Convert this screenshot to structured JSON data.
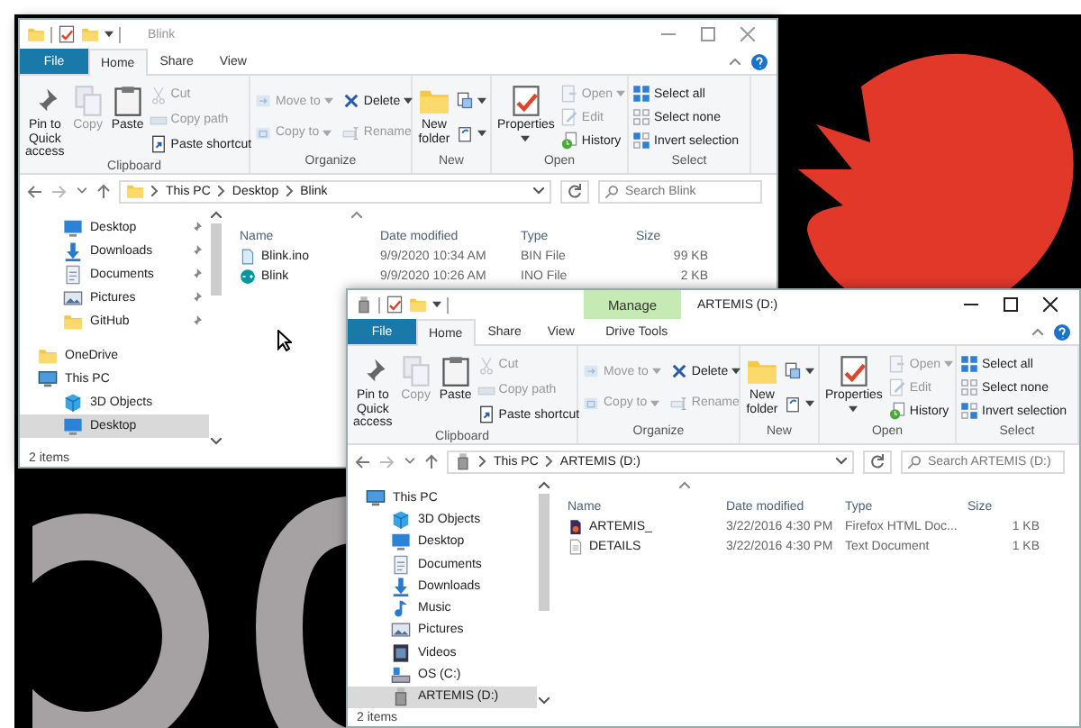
{
  "windows": [
    {
      "title": "Blink",
      "active": false,
      "tabs": [
        {
          "label": "File",
          "kind": "file",
          "selected": false
        },
        {
          "label": "Home",
          "kind": "tab",
          "selected": true
        },
        {
          "label": "Share",
          "kind": "tab",
          "selected": false
        },
        {
          "label": "View",
          "kind": "tab",
          "selected": false
        }
      ],
      "ribbon": [
        {
          "label": "Clipboard",
          "large": [
            {
              "label": "Pin to Quick access",
              "kind": "pin",
              "disabled": false
            },
            {
              "label": "Copy",
              "kind": "copy",
              "disabled": true
            },
            {
              "label": "Paste",
              "kind": "paste",
              "disabled": false
            }
          ],
          "small": [
            {
              "label": "Cut",
              "kind": "cut",
              "disabled": true,
              "dropdown": false
            },
            {
              "label": "Copy path",
              "kind": "copypath",
              "disabled": true,
              "dropdown": false
            },
            {
              "label": "Paste shortcut",
              "kind": "pasteshortcut",
              "disabled": false,
              "dropdown": false
            }
          ]
        },
        {
          "label": "Organize",
          "small": [
            {
              "label": "Move to",
              "kind": "moveto",
              "disabled": true,
              "dropdown": true
            },
            {
              "label": "Copy to",
              "kind": "copyto",
              "disabled": true,
              "dropdown": true
            },
            {
              "label": "Delete",
              "kind": "delete",
              "disabled": false,
              "dropdown": true
            },
            {
              "label": "Rename",
              "kind": "rename",
              "disabled": true,
              "dropdown": false
            }
          ]
        },
        {
          "label": "New",
          "large": [
            {
              "label": "New folder",
              "kind": "folder",
              "disabled": false
            }
          ],
          "small": [
            {
              "kind": "newitem",
              "disabled": false,
              "dropdown": true
            },
            {
              "kind": "easyaccess",
              "disabled": false,
              "dropdown": true
            }
          ]
        },
        {
          "label": "Open",
          "large": [
            {
              "label": "Properties",
              "kind": "properties",
              "disabled": false,
              "dropdown": true
            }
          ],
          "small": [
            {
              "label": "Open",
              "kind": "open",
              "disabled": true,
              "dropdown": true
            },
            {
              "label": "Edit",
              "kind": "edit",
              "disabled": true,
              "dropdown": false
            },
            {
              "label": "History",
              "kind": "history",
              "disabled": false,
              "dropdown": false
            }
          ]
        },
        {
          "label": "Select",
          "small": [
            {
              "label": "Select all",
              "kind": "selectall",
              "disabled": false,
              "dropdown": false
            },
            {
              "label": "Select none",
              "kind": "selectnone",
              "disabled": false,
              "dropdown": false
            },
            {
              "label": "Invert selection",
              "kind": "invert",
              "disabled": false,
              "dropdown": false
            }
          ]
        }
      ],
      "address": {
        "kind": "folder",
        "segments": [
          "This PC",
          "Desktop",
          "Blink"
        ]
      },
      "search": {
        "placeholder": "Search Blink"
      },
      "navigation": {
        "quick_access": [
          {
            "label": "Desktop",
            "kind": "desktop",
            "pinned": true
          },
          {
            "label": "Downloads",
            "kind": "downloads",
            "pinned": true
          },
          {
            "label": "Documents",
            "kind": "documents",
            "pinned": true
          },
          {
            "label": "Pictures",
            "kind": "pictures",
            "pinned": true
          },
          {
            "label": "GitHub",
            "kind": "folder",
            "pinned": true
          }
        ],
        "items": [
          {
            "label": "OneDrive",
            "kind": "folder",
            "selected": false
          },
          {
            "label": "This PC",
            "kind": "pc",
            "selected": false,
            "children": [
              {
                "label": "3D Objects",
                "kind": "objects3d",
                "selected": false
              },
              {
                "label": "Desktop",
                "kind": "desktop",
                "selected": true
              }
            ]
          }
        ]
      },
      "columns": [
        "Name",
        "Date modified",
        "Type",
        "Size"
      ],
      "files": [
        {
          "kind": "bin",
          "name": "Blink.ino",
          "date": "9/9/2020 10:34 AM",
          "type": "BIN File",
          "size": "99 KB"
        },
        {
          "kind": "arduino",
          "name": "Blink",
          "date": "9/9/2020 10:26 AM",
          "type": "INO File",
          "size": "2 KB"
        }
      ],
      "status": "2 items"
    },
    {
      "title": "ARTEMIS (D:)",
      "active": true,
      "context_header": "Manage",
      "tabs": [
        {
          "label": "File",
          "kind": "file",
          "selected": false
        },
        {
          "label": "Home",
          "kind": "tab",
          "selected": true
        },
        {
          "label": "Share",
          "kind": "tab",
          "selected": false
        },
        {
          "label": "View",
          "kind": "tab",
          "selected": false
        },
        {
          "label": "Drive Tools",
          "kind": "context",
          "selected": false
        }
      ],
      "ribbon": [
        {
          "label": "Clipboard",
          "large": [
            {
              "label": "Pin to Quick access",
              "kind": "pin",
              "disabled": false
            },
            {
              "label": "Copy",
              "kind": "copy",
              "disabled": true
            },
            {
              "label": "Paste",
              "kind": "paste",
              "disabled": false
            }
          ],
          "small": [
            {
              "label": "Cut",
              "kind": "cut",
              "disabled": true,
              "dropdown": false
            },
            {
              "label": "Copy path",
              "kind": "copypath",
              "disabled": true,
              "dropdown": false
            },
            {
              "label": "Paste shortcut",
              "kind": "pasteshortcut",
              "disabled": false,
              "dropdown": false
            }
          ]
        },
        {
          "label": "Organize",
          "small": [
            {
              "label": "Move to",
              "kind": "moveto",
              "disabled": true,
              "dropdown": true
            },
            {
              "label": "Copy to",
              "kind": "copyto",
              "disabled": true,
              "dropdown": true
            },
            {
              "label": "Delete",
              "kind": "delete",
              "disabled": false,
              "dropdown": true
            },
            {
              "label": "Rename",
              "kind": "rename",
              "disabled": true,
              "dropdown": false
            }
          ]
        },
        {
          "label": "New",
          "large": [
            {
              "label": "New folder",
              "kind": "folder",
              "disabled": false
            }
          ],
          "small": [
            {
              "kind": "newitem",
              "disabled": false,
              "dropdown": true
            },
            {
              "kind": "easyaccess",
              "disabled": false,
              "dropdown": true
            }
          ]
        },
        {
          "label": "Open",
          "large": [
            {
              "label": "Properties",
              "kind": "properties",
              "disabled": false,
              "dropdown": true
            }
          ],
          "small": [
            {
              "label": "Open",
              "kind": "open",
              "disabled": true,
              "dropdown": true
            },
            {
              "label": "Edit",
              "kind": "edit",
              "disabled": true,
              "dropdown": false
            },
            {
              "label": "History",
              "kind": "history",
              "disabled": false,
              "dropdown": false
            }
          ]
        },
        {
          "label": "Select",
          "small": [
            {
              "label": "Select all",
              "kind": "selectall",
              "disabled": false,
              "dropdown": false
            },
            {
              "label": "Select none",
              "kind": "selectnone",
              "disabled": false,
              "dropdown": false
            },
            {
              "label": "Invert selection",
              "kind": "invert",
              "disabled": false,
              "dropdown": false
            }
          ]
        }
      ],
      "address": {
        "kind": "usb",
        "segments": [
          "This PC",
          "ARTEMIS (D:)"
        ]
      },
      "search": {
        "placeholder": "Search ARTEMIS (D:)"
      },
      "navigation": {
        "items": [
          {
            "label": "This PC",
            "kind": "pc",
            "selected": false,
            "children": [
              {
                "label": "3D Objects",
                "kind": "objects3d",
                "selected": false
              },
              {
                "label": "Desktop",
                "kind": "desktop",
                "selected": false
              },
              {
                "label": "Documents",
                "kind": "documents",
                "selected": false
              },
              {
                "label": "Downloads",
                "kind": "downloads",
                "selected": false
              },
              {
                "label": "Music",
                "kind": "music",
                "selected": false
              },
              {
                "label": "Pictures",
                "kind": "pictures",
                "selected": false
              },
              {
                "label": "Videos",
                "kind": "videos",
                "selected": false
              },
              {
                "label": "OS (C:)",
                "kind": "drive",
                "selected": false
              },
              {
                "label": "ARTEMIS (D:)",
                "kind": "usb",
                "selected": true
              }
            ]
          }
        ]
      },
      "columns": [
        "Name",
        "Date modified",
        "Type",
        "Size"
      ],
      "files": [
        {
          "kind": "html",
          "name": "ARTEMIS_",
          "date": "3/22/2016 4:30 PM",
          "type": "Firefox HTML Doc...",
          "size": "1 KB"
        },
        {
          "kind": "text",
          "name": "DETAILS",
          "date": "3/22/2016 4:30 PM",
          "type": "Text Document",
          "size": "1 KB"
        }
      ],
      "status": "2 items"
    }
  ]
}
